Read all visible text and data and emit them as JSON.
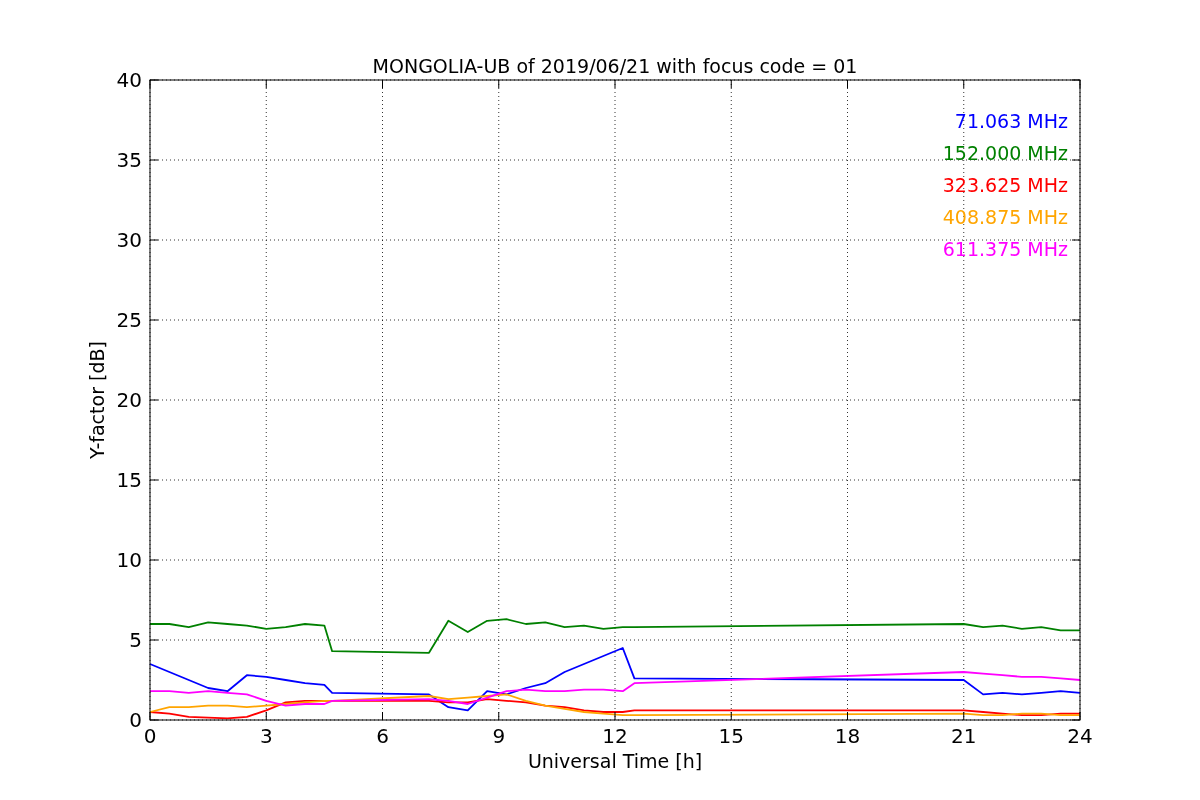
{
  "figure": {
    "chart_data": {
      "type": "line",
      "title": "MONGOLIA-UB of 2019/06/21 with focus code = 01",
      "xlabel": "Universal Time [h]",
      "ylabel": "Y-factor [dB]",
      "x": [
        0,
        0.5,
        1,
        1.5,
        2,
        2.5,
        3,
        3.5,
        4,
        4.5,
        4.7,
        7.2,
        7.7,
        8.2,
        8.7,
        9.2,
        9.7,
        10.2,
        10.7,
        11.2,
        11.7,
        12.2,
        12.5,
        21,
        21.5,
        22,
        22.5,
        23,
        23.5,
        24
      ],
      "series": [
        {
          "name": "71.063 MHz",
          "color": "#0000ff",
          "values": [
            3.5,
            3,
            2.5,
            2,
            1.8,
            2.8,
            2.7,
            2.5,
            2.3,
            2.2,
            1.7,
            1.6,
            0.8,
            0.6,
            1.8,
            1.6,
            2,
            2.3,
            3,
            3.5,
            4,
            4.5,
            2.6,
            2.5,
            1.6,
            1.7,
            1.6,
            1.7,
            1.8,
            1.7
          ]
        },
        {
          "name": "152.000 MHz",
          "color": "#008000",
          "values": [
            6,
            6,
            5.8,
            6.1,
            6,
            5.9,
            5.7,
            5.8,
            6,
            5.9,
            4.3,
            4.2,
            6.2,
            5.5,
            6.2,
            6.3,
            6,
            6.1,
            5.8,
            5.9,
            5.7,
            5.8,
            5.8,
            6,
            5.8,
            5.9,
            5.7,
            5.8,
            5.6,
            5.6
          ]
        },
        {
          "name": "323.625 MHz",
          "color": "#ff0000",
          "values": [
            0.5,
            0.4,
            0.2,
            0.15,
            0.1,
            0.2,
            0.6,
            1.1,
            1.2,
            1.2,
            1.2,
            1.2,
            1.1,
            1.1,
            1.3,
            1.2,
            1.1,
            0.9,
            0.8,
            0.6,
            0.5,
            0.5,
            0.6,
            0.6,
            0.5,
            0.4,
            0.3,
            0.3,
            0.4,
            0.4
          ]
        },
        {
          "name": "408.875 MHz",
          "color": "#ffa500",
          "values": [
            0.5,
            0.8,
            0.8,
            0.9,
            0.9,
            0.8,
            0.9,
            1,
            1.1,
            1.2,
            1.2,
            1.5,
            1.3,
            1.4,
            1.5,
            1.6,
            1.2,
            0.9,
            0.7,
            0.5,
            0.4,
            0.3,
            0.3,
            0.4,
            0.3,
            0.3,
            0.4,
            0.4,
            0.3,
            0.3
          ]
        },
        {
          "name": "611.375 MHz",
          "color": "#ff00ff",
          "values": [
            1.8,
            1.8,
            1.7,
            1.8,
            1.7,
            1.6,
            1.2,
            0.9,
            1,
            1,
            1.2,
            1.3,
            1.2,
            1,
            1.4,
            1.8,
            1.9,
            1.8,
            1.8,
            1.9,
            1.9,
            1.8,
            2.3,
            3,
            2.9,
            2.8,
            2.7,
            2.7,
            2.6,
            2.5
          ]
        }
      ],
      "xlim": [
        0,
        24
      ],
      "ylim": [
        0,
        40
      ],
      "xticks": [
        0,
        3,
        6,
        9,
        12,
        15,
        18,
        21,
        24
      ],
      "yticks": [
        0,
        5,
        10,
        15,
        20,
        25,
        30,
        35,
        40
      ],
      "grid": true
    }
  }
}
